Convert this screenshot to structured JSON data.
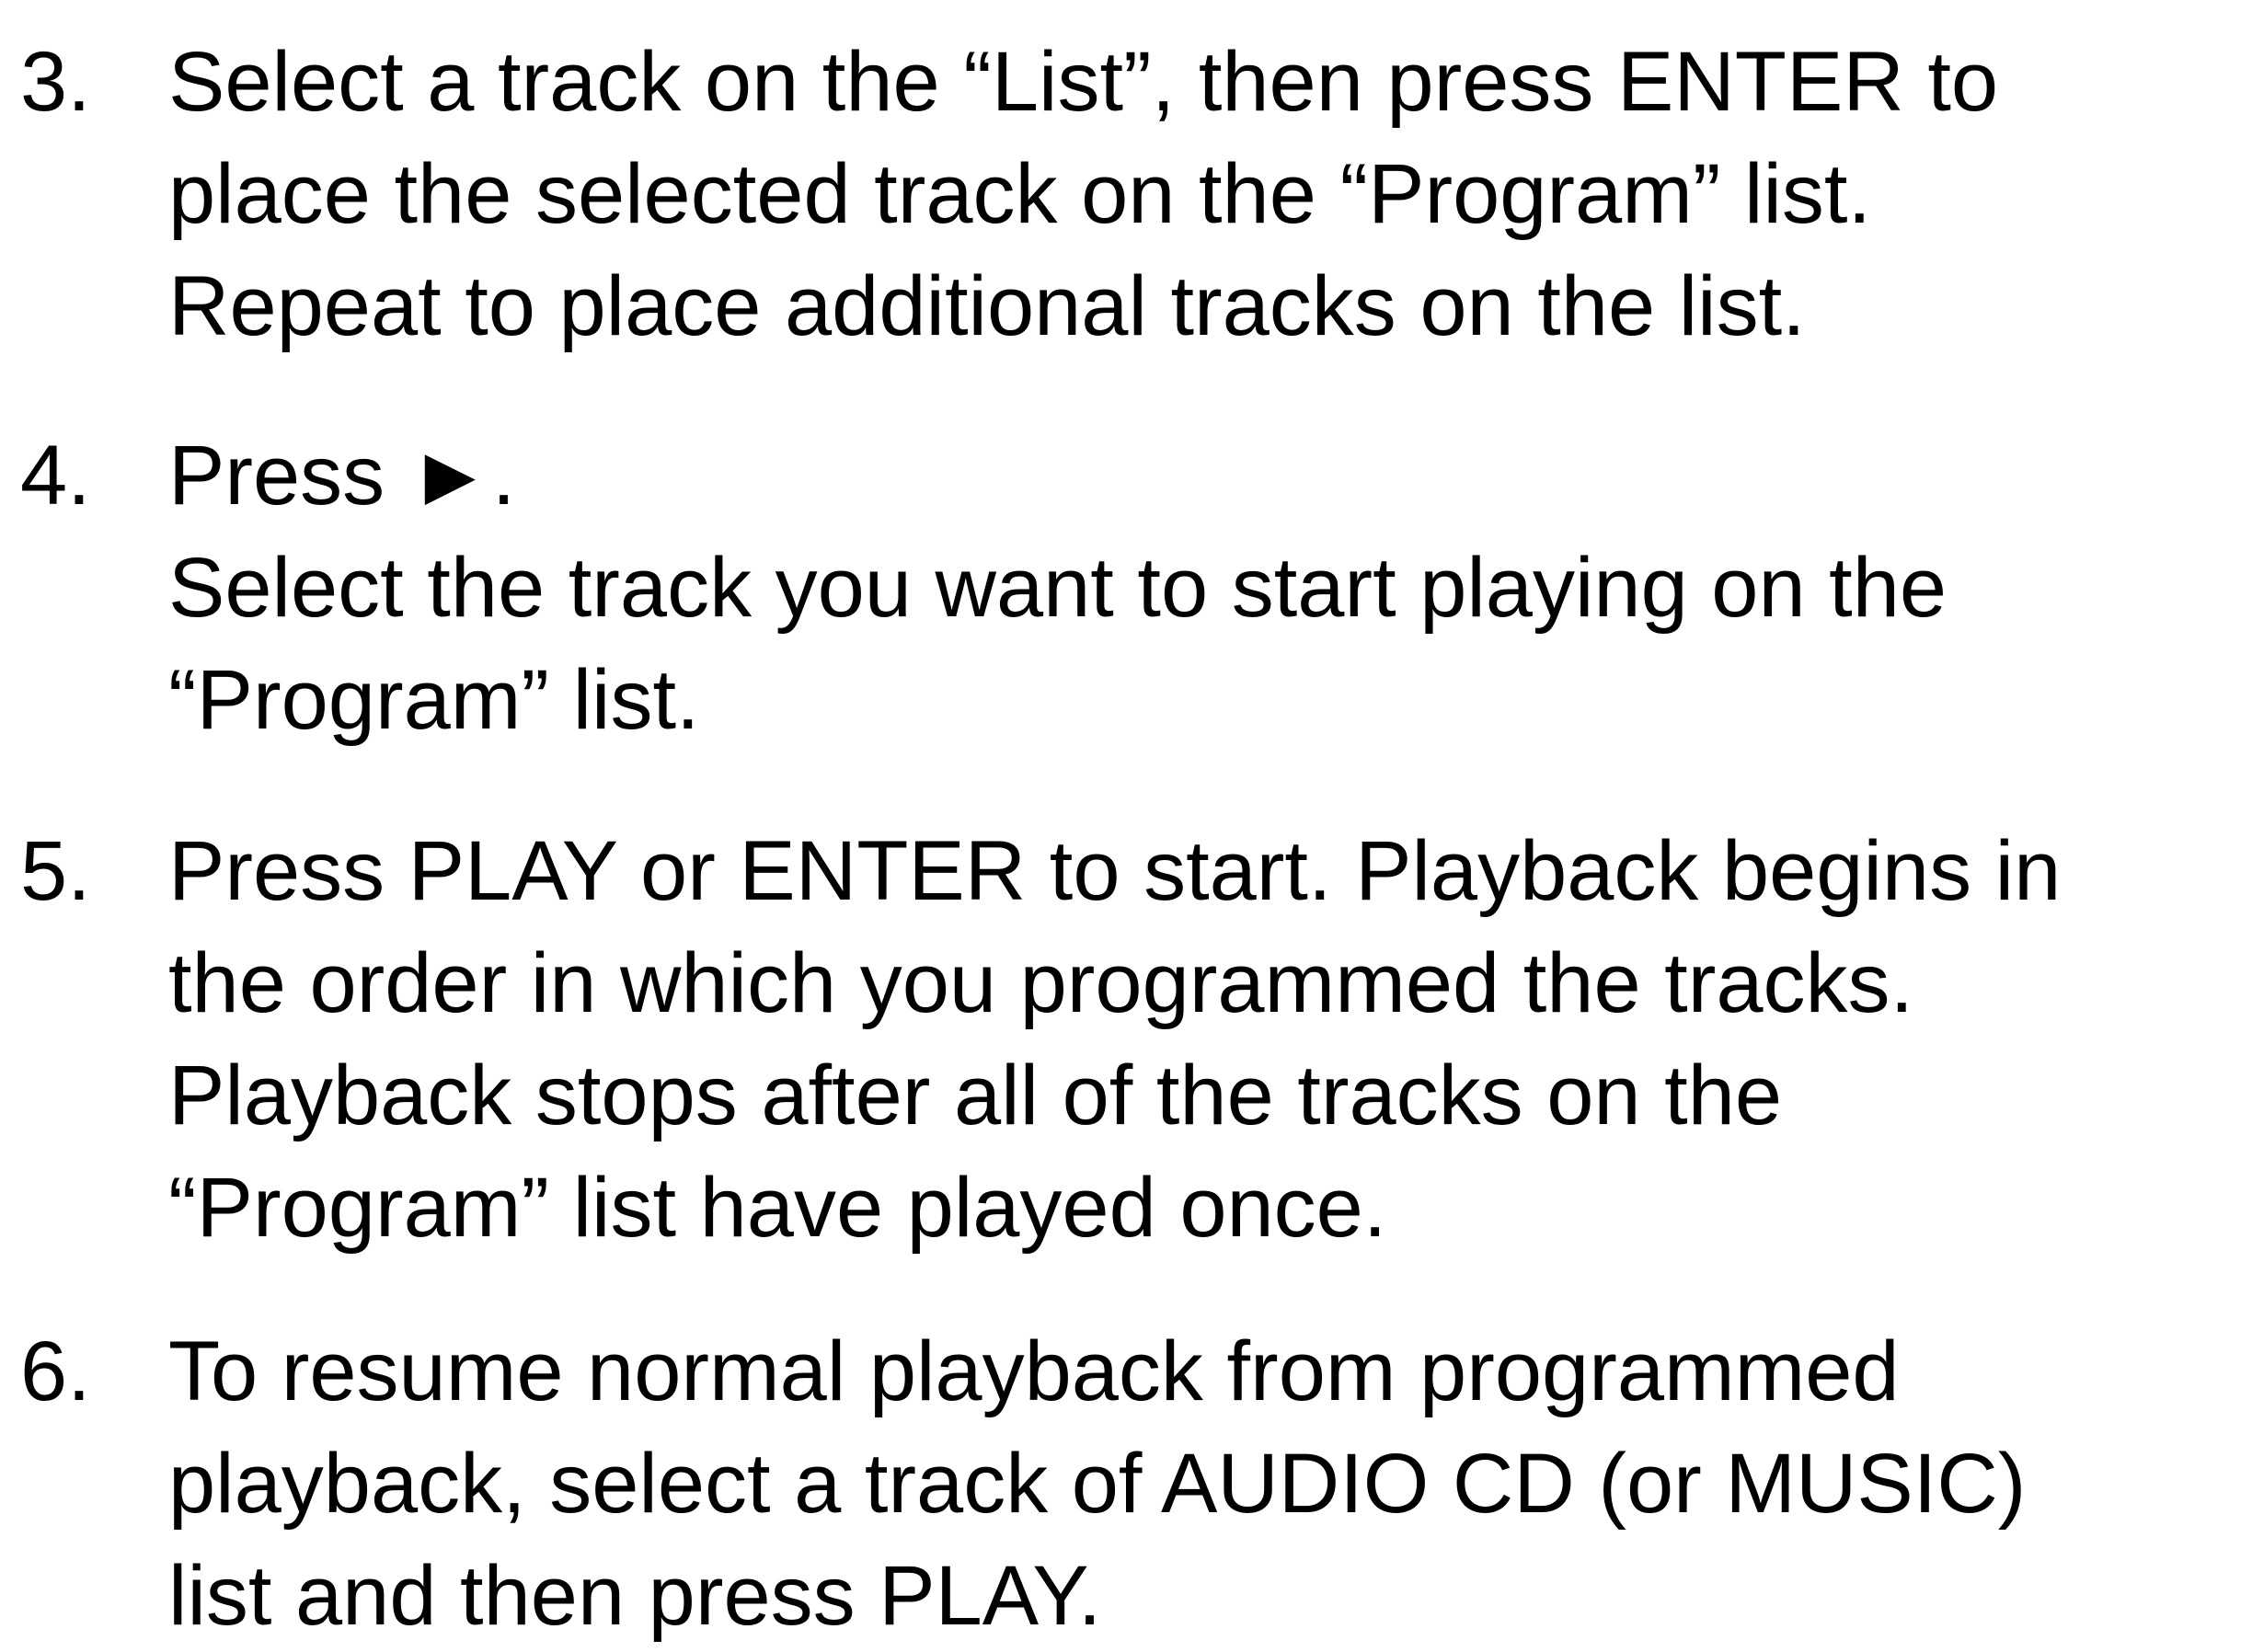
{
  "steps": [
    {
      "number": "3.",
      "lines": [
        "Select a track on the “List”, then press ENTER to",
        "place the selected track on the “Program” list.",
        "Repeat to place additional tracks on the list."
      ]
    },
    {
      "number": "4.",
      "lines": [
        "Press ►.",
        "Select the track you want to start playing on the",
        "“Program” list."
      ]
    },
    {
      "number": "5.",
      "lines": [
        "Press PLAY or ENTER to start. Playback begins in",
        "the order in which you programmed the tracks.",
        "Playback stops after all of the tracks on the",
        "“Program” list have played once."
      ]
    },
    {
      "number": "6.",
      "lines": [
        "To resume normal playback from programmed",
        "playback, select a track of AUDIO CD (or MUSIC)",
        "list and then press PLAY."
      ]
    }
  ]
}
